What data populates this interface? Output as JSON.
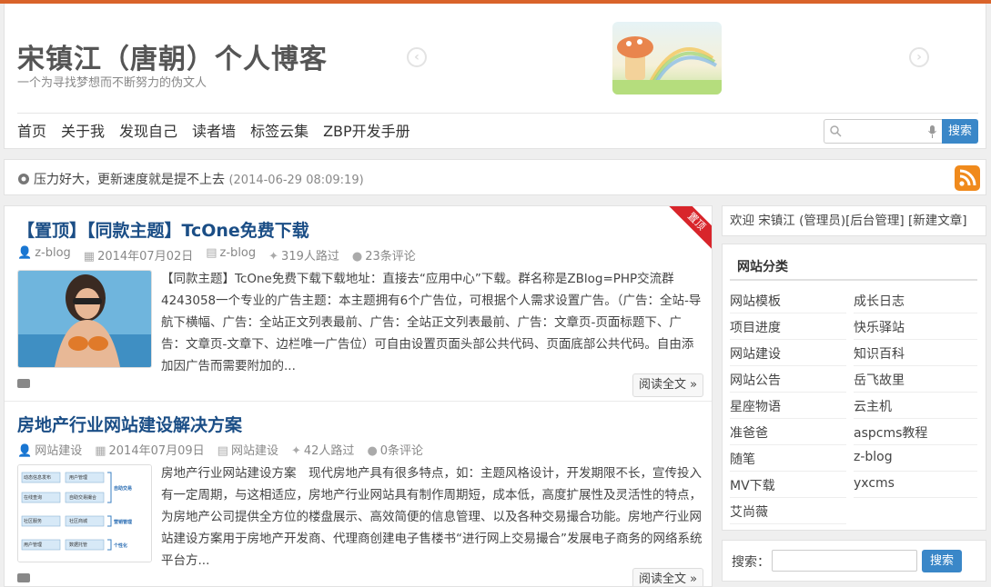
{
  "header": {
    "title": "宋镇江（唐朝）个人博客",
    "subtitle": "一个为寻找梦想而不断努力的伪文人",
    "nav": [
      "首页",
      "关于我",
      "发现自己",
      "读者墙",
      "标签云集",
      "ZBP开发手册"
    ],
    "search_button": "搜索",
    "accent_color": "#d9632a"
  },
  "notice": {
    "text": "压力好大，更新速度就是提不上去",
    "time": "(2014-06-29 08:09:19)"
  },
  "posts": [
    {
      "title": "【置顶】【同款主题】TcOne免费下载",
      "ribbon": "置顶",
      "author": "z-blog",
      "date": "2014年07月02日",
      "category": "z-blog",
      "views": "319人路过",
      "comments": "23条评论",
      "excerpt": "【同款主题】TcOne免费下载下载地址：直接去“应用中心”下载。群名称是ZBlog=PHP交流群4243058一个专业的广告主题：本主题拥有6个广告位，可根据个人需求设置广告。（广告：全站-导航下横幅、广告：全站正文列表最前、广告：全站正文列表最前、广告：文章页-页面标题下、广告：文章页-文章下、边栏唯一广告位）可自由设置页面头部公共代码、页面底部公共代码。自由添加因广告而需要附加的...",
      "readmore": "阅读全文 »"
    },
    {
      "title": "房地产行业网站建设解决方案",
      "author": "网站建设",
      "date": "2014年07月09日",
      "category": "网站建设",
      "views": "42人路过",
      "comments": "0条评论",
      "excerpt": "房地产行业网站建设方案　现代房地产具有很多特点，如：主题风格设计，开发期限不长，宣传投入有一定周期，与这相适应，房地产行业网站具有制作周期短，成本低，高度扩展性及灵活性的特点，为房地产公司提供全方位的楼盘展示、高效简便的信息管理、以及各种交易撮合功能。房地产行业网站建设方案用于房地产开发商、代理商创建电子售楼书“进行网上交易撮合”发展电子商务的网络系统平台方...",
      "readmore": "阅读全文 »",
      "diagram_labels": [
        "动态信息发布",
        "用户管理",
        "自助交易撮合",
        "在线查询",
        "自助交易",
        "社区服务",
        "社区商城",
        "营销管理",
        "用户管理",
        "数据托管",
        "个性化"
      ]
    }
  ],
  "sidebar": {
    "welcome": "欢迎 宋镇江 (管理员)[后台管理] [新建文章]",
    "categories_title": "网站分类",
    "categories_left": [
      "网站模板",
      "项目进度",
      "网站建设",
      "网站公告",
      "星座物语",
      "准爸爸",
      "随笔",
      "MV下载",
      "艾尚薇"
    ],
    "categories_right": [
      "成长日志",
      "快乐驿站",
      "知识百科",
      "岳飞故里",
      "云主机",
      "aspcms教程",
      "z-blog",
      "yxcms"
    ],
    "search_label": "搜索：",
    "search_button": "搜索"
  }
}
